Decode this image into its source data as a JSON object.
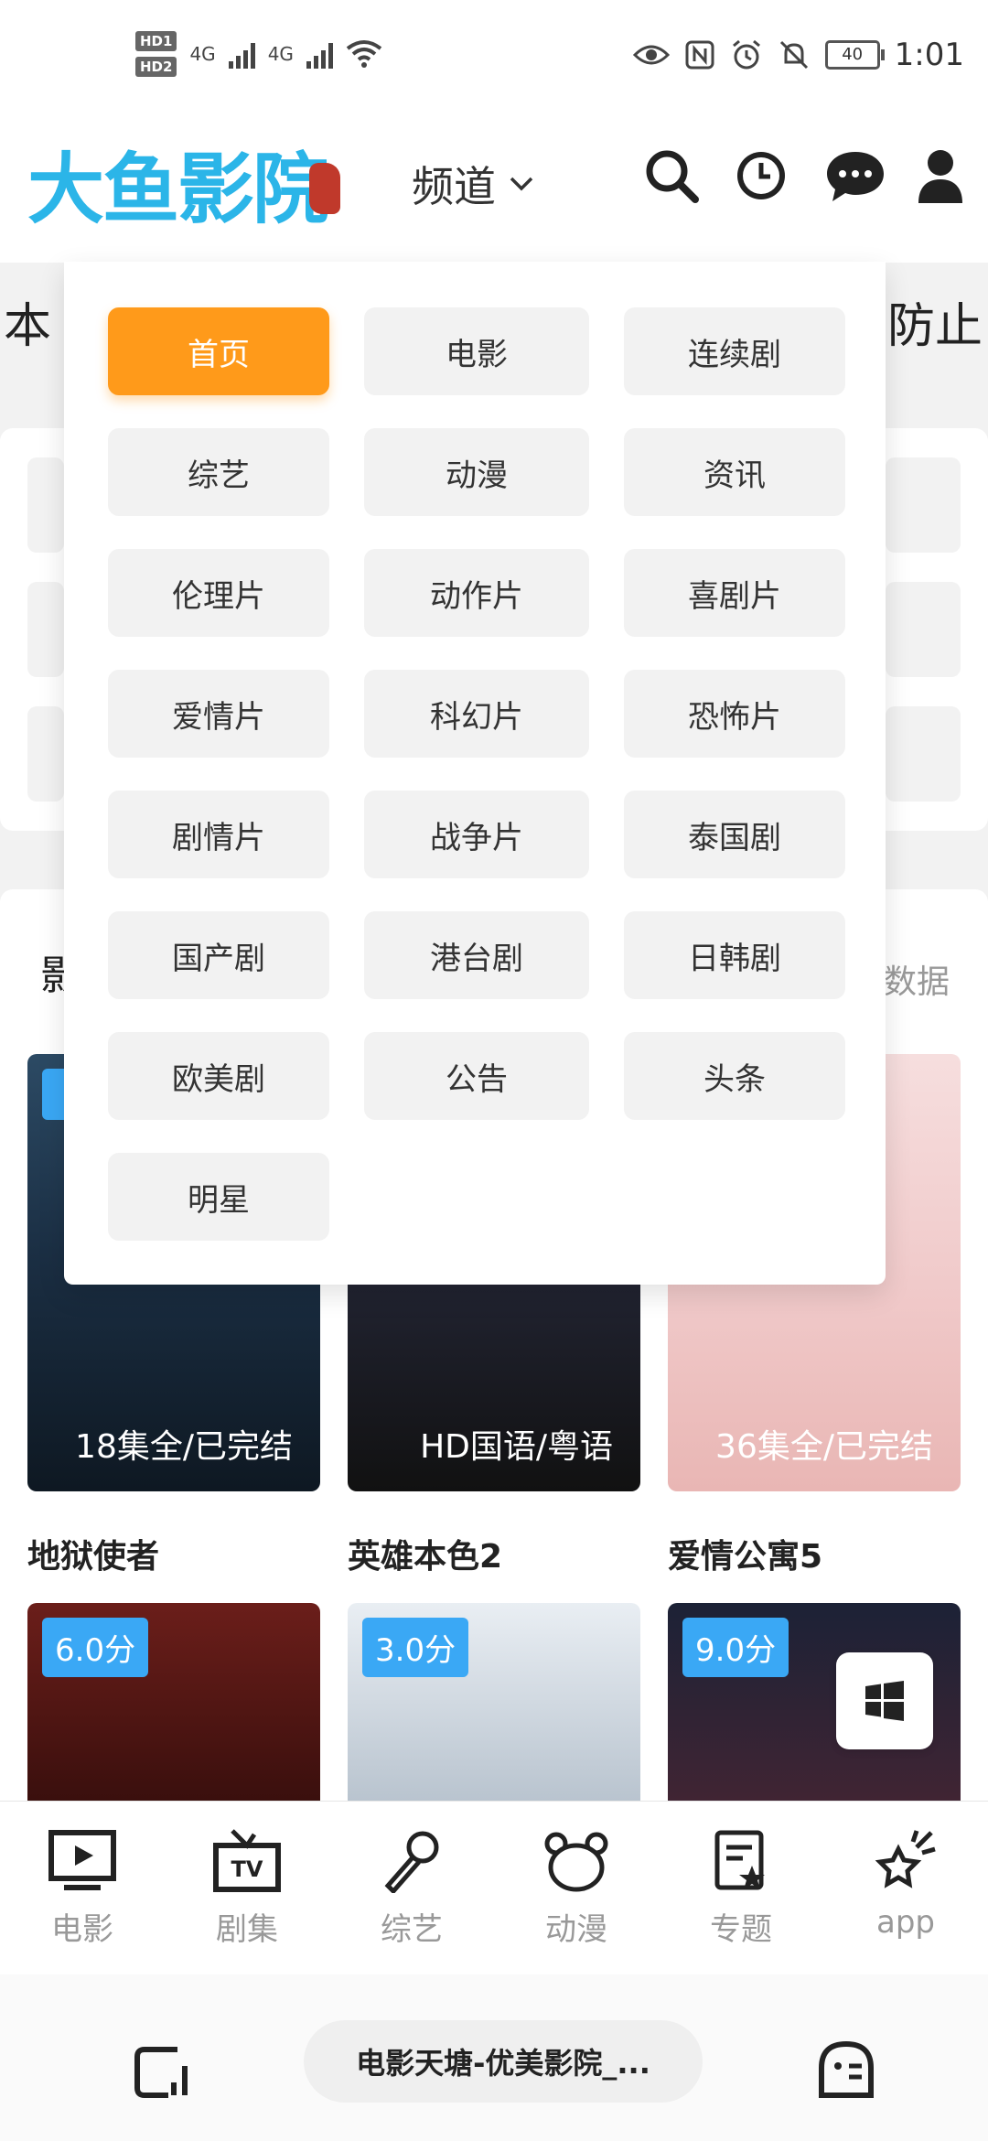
{
  "status": {
    "hd1": "HD1",
    "hd2": "HD2",
    "net1": "4G",
    "net2": "4G",
    "battery": "40",
    "time": "1:01"
  },
  "header": {
    "logo": "大鱼影院",
    "channel_label": "频道"
  },
  "background": {
    "notice_left": "本",
    "notice_right": "防止",
    "section_left": "影",
    "section_right": "数据",
    "row1": [
      {
        "title": "地狱使者",
        "episodes": "18集全/已完结"
      },
      {
        "title": "英雄本色2",
        "episodes": "HD国语/粤语"
      },
      {
        "title": "爱情公寓5",
        "episodes": "36集全/已完结"
      }
    ],
    "row2": [
      {
        "score": "6.0分"
      },
      {
        "score": "3.0分"
      },
      {
        "score": "9.0分"
      }
    ]
  },
  "dropdown": {
    "items": [
      "首页",
      "电影",
      "连续剧",
      "综艺",
      "动漫",
      "资讯",
      "伦理片",
      "动作片",
      "喜剧片",
      "爱情片",
      "科幻片",
      "恐怖片",
      "剧情片",
      "战争片",
      "泰国剧",
      "国产剧",
      "港台剧",
      "日韩剧",
      "欧美剧",
      "公告",
      "头条",
      "明星"
    ],
    "active_index": 0
  },
  "bottom_nav": {
    "items": [
      {
        "label": "电影",
        "icon": "movie-screen-icon"
      },
      {
        "label": "剧集",
        "icon": "tv-icon"
      },
      {
        "label": "综艺",
        "icon": "microphone-icon"
      },
      {
        "label": "动漫",
        "icon": "bear-icon"
      },
      {
        "label": "专题",
        "icon": "topic-icon"
      },
      {
        "label": "app",
        "icon": "sparkle-icon"
      }
    ]
  },
  "browser": {
    "url_title": "电影天塘-优美影院_..."
  },
  "colors": {
    "accent": "#ff9a1a",
    "logo": "#2bb5e8",
    "score_badge": "#3aa8f5"
  }
}
